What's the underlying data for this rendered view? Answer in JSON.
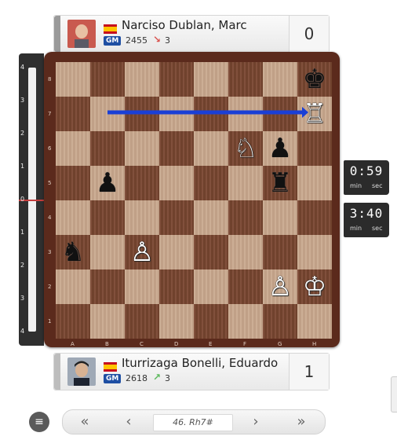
{
  "top_player": {
    "name": "Narciso Dublan, Marc",
    "title": "GM",
    "rating": "2455",
    "delta": "3",
    "delta_direction": "down",
    "score": "0",
    "flag": "spain"
  },
  "bottom_player": {
    "name": "Iturrizaga Bonelli, Eduardo",
    "title": "GM",
    "rating": "2618",
    "delta": "3",
    "delta_direction": "up",
    "score": "1",
    "flag": "spain"
  },
  "eval_bar": {
    "labels": [
      "4",
      "3",
      "2",
      "1",
      "0",
      "1",
      "2",
      "3",
      "4"
    ],
    "value": 0
  },
  "clocks": {
    "top": {
      "time": "0:59",
      "min_label": "min",
      "sec_label": "sec"
    },
    "bottom": {
      "time": "3:40",
      "min_label": "min",
      "sec_label": "sec"
    }
  },
  "board": {
    "files": [
      "A",
      "B",
      "C",
      "D",
      "E",
      "F",
      "G",
      "H"
    ],
    "ranks": [
      "8",
      "7",
      "6",
      "5",
      "4",
      "3",
      "2",
      "1"
    ],
    "pieces": [
      {
        "square": "h8",
        "piece": "king",
        "color": "black",
        "glyph": "♚"
      },
      {
        "square": "h7",
        "piece": "rook",
        "color": "white",
        "glyph": "♖"
      },
      {
        "square": "f6",
        "piece": "knight",
        "color": "white",
        "glyph": "♘"
      },
      {
        "square": "g6",
        "piece": "pawn",
        "color": "black",
        "glyph": "♟"
      },
      {
        "square": "b5",
        "piece": "pawn",
        "color": "black",
        "glyph": "♟"
      },
      {
        "square": "g5",
        "piece": "rook",
        "color": "black",
        "glyph": "♜"
      },
      {
        "square": "a3",
        "piece": "knight",
        "color": "black",
        "glyph": "♞"
      },
      {
        "square": "c3",
        "piece": "pawn",
        "color": "white",
        "glyph": "♙"
      },
      {
        "square": "g2",
        "piece": "pawn",
        "color": "white",
        "glyph": "♙"
      },
      {
        "square": "h2",
        "piece": "king",
        "color": "white",
        "glyph": "♔"
      }
    ],
    "last_move": {
      "from": "b7",
      "to": "h7"
    },
    "arrow_color": "#1a3fd6"
  },
  "nav": {
    "first_icon": "«",
    "prev_icon": "‹",
    "move_label": "46. Rh7#",
    "next_icon": "›",
    "last_icon": "»",
    "menu_icon": "≡"
  }
}
